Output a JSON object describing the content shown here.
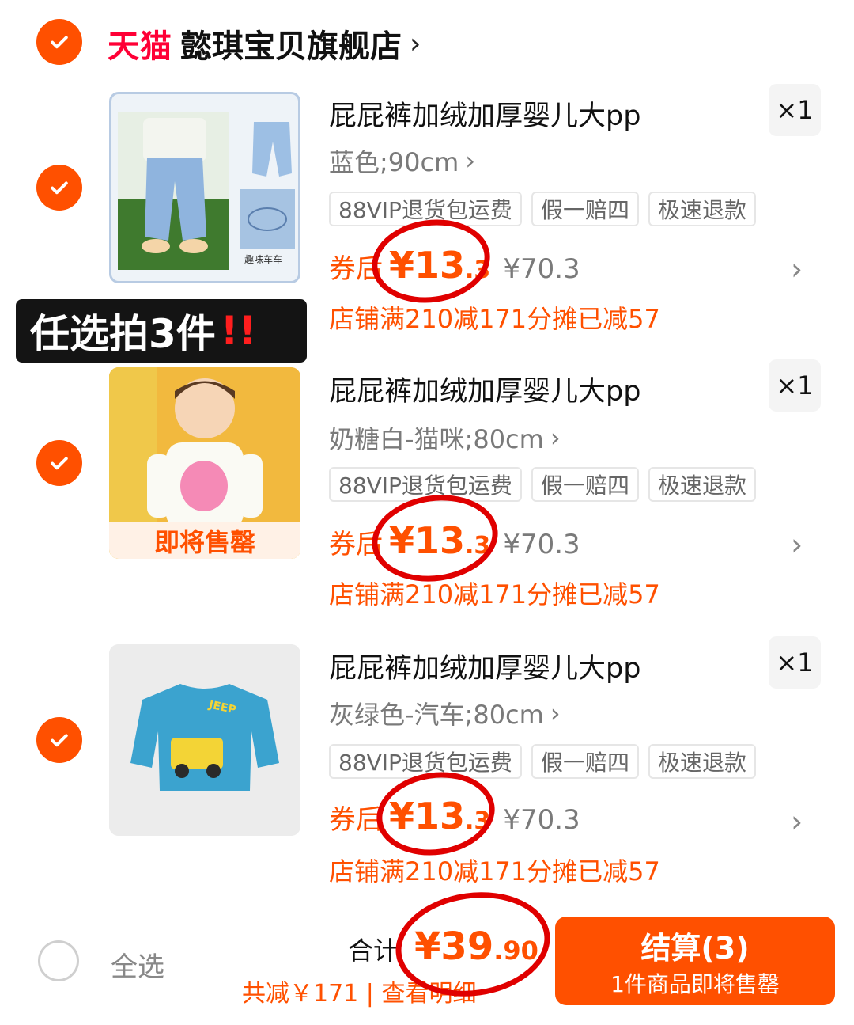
{
  "store": {
    "logo": "天猫",
    "name": "懿琪宝贝旗舰店",
    "chevron": "›"
  },
  "badge": {
    "text": "任选拍3件",
    "emphasis": "!!"
  },
  "items": [
    {
      "title": "屁屁裤加绒加厚婴儿大pp",
      "spec": "蓝色;90cm",
      "qty": "×1",
      "tags": [
        "88VIP退货包运费",
        "假一赔四",
        "极速退款"
      ],
      "price_prefix": "券后",
      "price_int": "¥13",
      "price_dec": ".3",
      "orig": "¥70.3",
      "promo": "店铺满210减171分摊已减57",
      "thumb_caption": "- 趣味车车 -",
      "stock_label": ""
    },
    {
      "title": "屁屁裤加绒加厚婴儿大pp",
      "spec": "奶糖白-猫咪;80cm",
      "qty": "×1",
      "tags": [
        "88VIP退货包运费",
        "假一赔四",
        "极速退款"
      ],
      "price_prefix": "券后",
      "price_int": "¥13",
      "price_dec": ".3",
      "orig": "¥70.3",
      "promo": "店铺满210减171分摊已减57",
      "thumb_caption": "",
      "stock_label": "即将售罄"
    },
    {
      "title": "屁屁裤加绒加厚婴儿大pp",
      "spec": "灰绿色-汽车;80cm",
      "qty": "×1",
      "tags": [
        "88VIP退货包运费",
        "假一赔四",
        "极速退款"
      ],
      "price_prefix": "券后",
      "price_int": "¥13",
      "price_dec": ".3",
      "orig": "¥70.3",
      "promo": "店铺满210减171分摊已减57",
      "thumb_caption": "JEEP",
      "stock_label": ""
    }
  ],
  "footer": {
    "select_all": "全选",
    "total_label": "合计",
    "total_int": "¥39",
    "total_dec": ".90",
    "savings": "共减￥171 | 查看明细",
    "checkout_label": "结算(3)",
    "checkout_note": "1件商品即将售罄"
  },
  "icons": {
    "check": "check-icon",
    "chevron": "chevron-right-icon"
  },
  "colors": {
    "accent": "#ff5000",
    "tmall": "#ff0036",
    "annotation": "#e00000"
  }
}
